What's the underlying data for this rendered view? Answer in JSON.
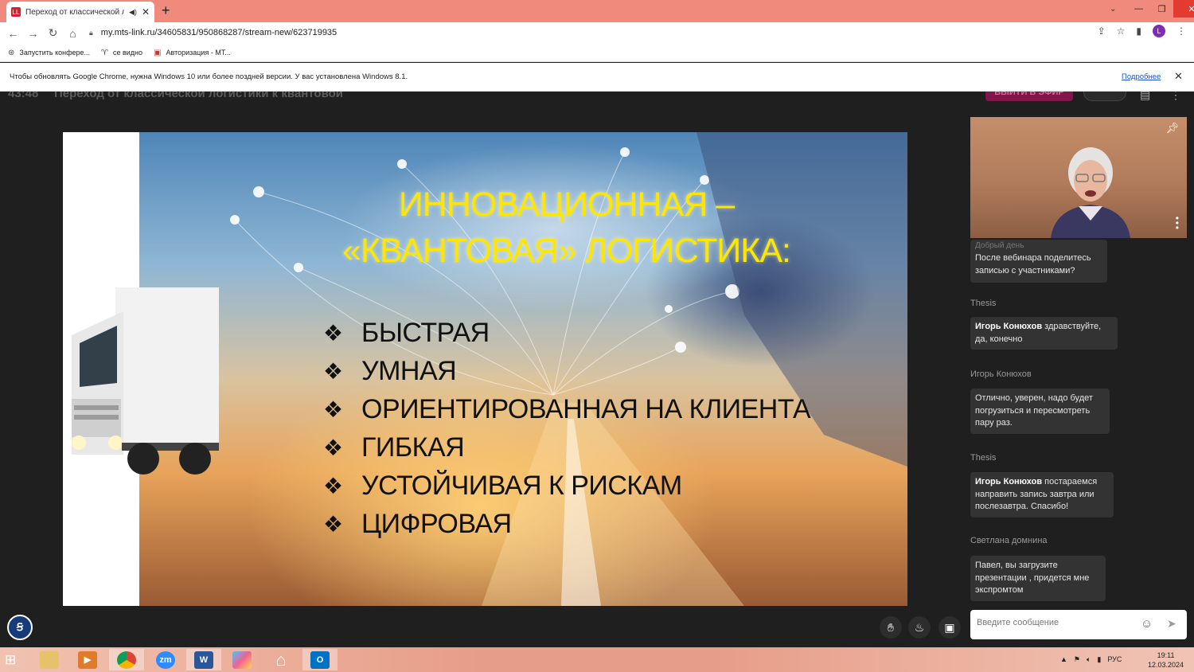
{
  "browser": {
    "tab_title": "Переход от классической л",
    "tab_favicon": "LL",
    "new_tab": "+",
    "url": "my.mts-link.ru/34605831/950868287/stream-new/623719935",
    "profile_initial": "L",
    "bookmarks": [
      {
        "label": "Запустить конфере...",
        "icon": "conference-icon"
      },
      {
        "label": "се видно",
        "icon": "globe-icon"
      },
      {
        "label": "Авторизация - МТ...",
        "icon": "mts-icon"
      }
    ],
    "infobar_text": "Чтобы обновлять Google Chrome, нужна Windows 10 или более поздней версии. У вас установлена Windows 8.1.",
    "infobar_link": "Подробнее"
  },
  "webinar": {
    "timer": "43:48",
    "title": "Переход от классической логистики к квантовой",
    "on_air_button": "ВЫЙТИ В ЭФИР",
    "accent_color": "#82164b"
  },
  "slide": {
    "title_line1": "ИННОВАЦИОННАЯ –",
    "title_line2": "«КВАНТОВАЯ» ЛОГИСТИКА:",
    "bullet_mark": "❖",
    "bullets": [
      "БЫСТРАЯ",
      "УМНАЯ",
      "ОРИЕНТИРОВАННАЯ НА КЛИЕНТА",
      "ГИБКАЯ",
      "УСТОЙЧИВАЯ К РИСКАМ",
      "ЦИФРОВАЯ"
    ],
    "title_color": "#ffe600"
  },
  "chat": {
    "partial_author": "Добрый день",
    "messages": [
      {
        "author": "",
        "mention": "",
        "text": "После вебинара поделитесь записью с участниками?"
      },
      {
        "author": "Thesis",
        "mention": "Игорь Конюхов",
        "text": " здравствуйте, да, конечно"
      },
      {
        "author": "Игорь Конюхов",
        "mention": "",
        "text": "Отлично, уверен, надо будет погрузиться и пересмотреть пару раз."
      },
      {
        "author": "Thesis",
        "mention": "Игорь Конюхов",
        "text": " постараемся направить запись завтра или послезавтра. Спасибо!"
      },
      {
        "author": "Светлана домнина",
        "mention": "",
        "text": "Павел, вы загрузите презентации , придется мне экспромтом"
      }
    ],
    "input_placeholder": "Введите сообщение"
  },
  "taskbar": {
    "apps": [
      "explorer",
      "media-player",
      "chrome",
      "zoom",
      "word",
      "paint",
      "home",
      "outlook"
    ],
    "zoom_label": "zm",
    "word_label": "W",
    "outlook_label": "O",
    "language": "РУС",
    "time": "19:11",
    "date": "12.03.2024"
  }
}
